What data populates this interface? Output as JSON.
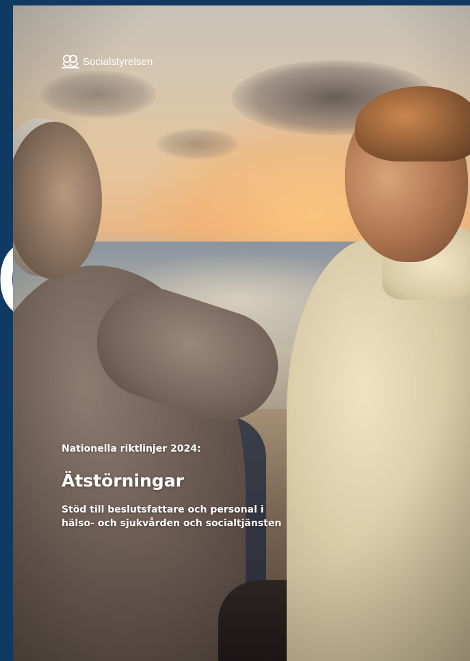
{
  "page": {
    "background_color": "#0f3a63",
    "edge_letter": "d"
  },
  "cover": {
    "logo": {
      "icon": "socialstyrelsen-emblem-icon",
      "text": "Socialstyrelsen"
    },
    "series": "Nationella riktlinjer 2024:",
    "title": "Ätstörningar",
    "subtitle_lines": [
      "Stöd till beslutsfattare och personal i",
      "hälso- och sjukvården och socialtjänsten"
    ]
  }
}
